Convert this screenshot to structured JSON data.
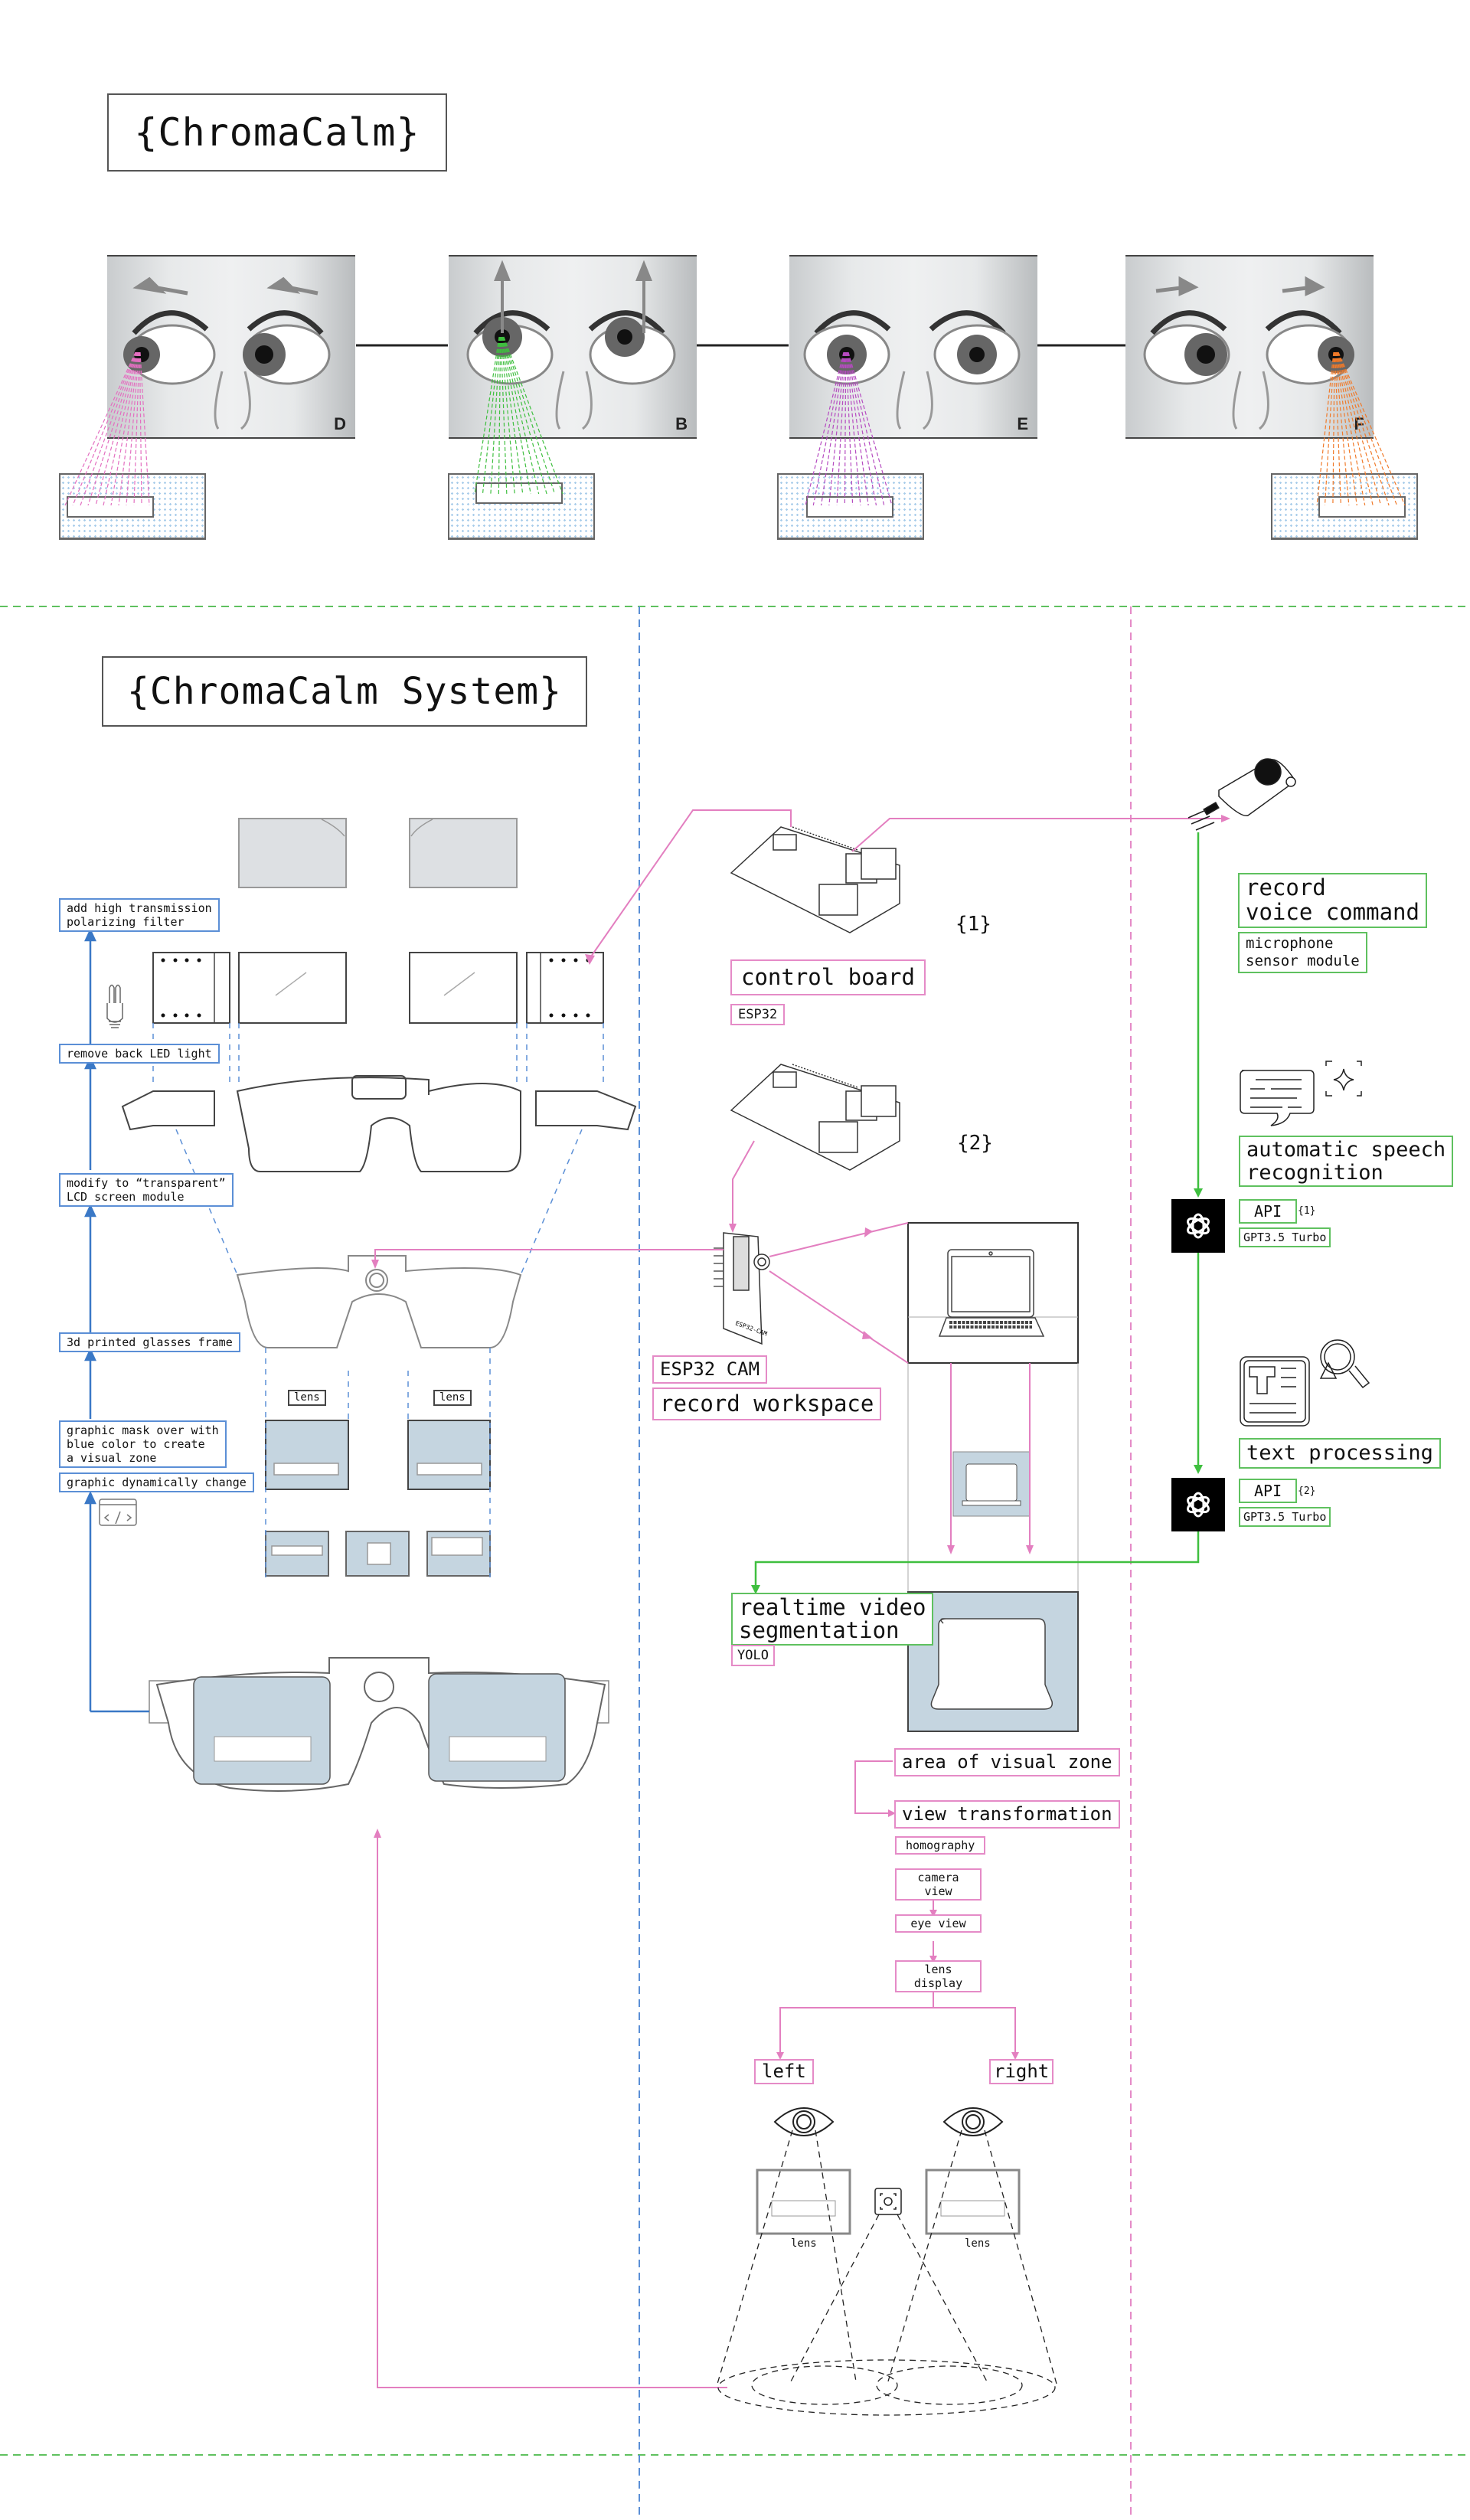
{
  "header": {
    "title": "{ChromaCalm}"
  },
  "gaze_panels": [
    {
      "letter": "D",
      "beam_color": "#e36fc0",
      "direction": "left"
    },
    {
      "letter": "B",
      "beam_color": "#3fbf3f",
      "direction": "up"
    },
    {
      "letter": "E",
      "beam_color": "#b54bc0",
      "direction": "center"
    },
    {
      "letter": "F",
      "beam_color": "#f07a2a",
      "direction": "right"
    }
  ],
  "system": {
    "title": "{ChromaCalm System}",
    "build_steps": [
      "add high transmission\npolarizing filter",
      "remove back LED light",
      "modify to “transparent”\nLCD screen module",
      "3d printed glasses frame",
      "graphic mask over with\nblue color to create\na visual zone",
      "graphic dynamically change"
    ],
    "lens_labels": [
      "lens",
      "lens"
    ]
  },
  "hardware": {
    "board1_number": "{1}",
    "board1_label": "control board",
    "board1_sub": "ESP32",
    "board2_number": "{2}",
    "cam_label": "ESP32 CAM",
    "cam_sub": "record workspace",
    "cam_chip_text": "ESP32-CAM"
  },
  "pipeline": {
    "segmentation": "realtime video\nsegmentation",
    "segmentation_model": "YOLO",
    "area": "area of visual zone",
    "transform": "view transformation",
    "homography": "homography",
    "steps": [
      "camera view",
      "eye view",
      "lens display"
    ],
    "left": "left",
    "right": "right",
    "lens_caption": "lens"
  },
  "voice": {
    "record": "record\nvoice command",
    "sensor": "microphone\nsensor module",
    "asr": "automatic speech\nrecognition",
    "api1": "API",
    "api1_ref": "{1}",
    "model1": "GPT3.5 Turbo",
    "text": "text processing",
    "api2": "API",
    "api2_ref": "{2}",
    "model2": "GPT3.5 Turbo"
  },
  "colors": {
    "blue": "#5b8fd6",
    "pink": "#e58bc7",
    "green": "#5fc15f",
    "lens_fill": "#c5d5e0",
    "filter_fill": "#dde0e3"
  }
}
